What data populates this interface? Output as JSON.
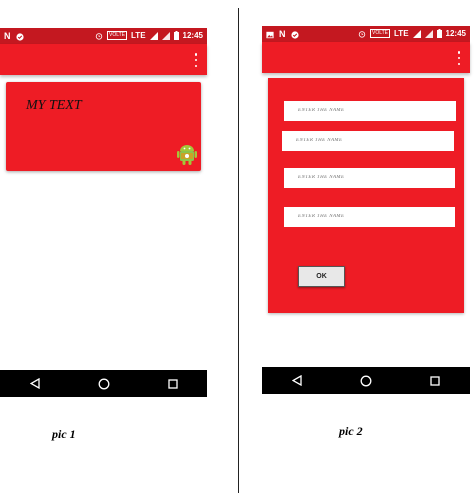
{
  "status_bar": {
    "time": "12:45",
    "network": "LTE",
    "volte": "VOLTE"
  },
  "pic1": {
    "card_text": "MY TEXT",
    "caption": "pic 1"
  },
  "pic2": {
    "fields": [
      {
        "placeholder": "ENTER THE NAME"
      },
      {
        "placeholder": "ENTER THE NAME"
      },
      {
        "placeholder": "ENTER THE NAME"
      },
      {
        "placeholder": "ENTER THE NAME"
      }
    ],
    "ok_label": "OK",
    "caption": "pic 2"
  },
  "colors": {
    "statusbar": "#c41820",
    "appbar": "#ee1c25",
    "card": "#ee1c25",
    "navbar": "#000000"
  },
  "icons": [
    "notification-n-icon",
    "check-circle-icon",
    "alarm-icon",
    "signal-icon",
    "battery-icon",
    "overflow-menu-icon",
    "back-icon",
    "home-icon",
    "recents-icon",
    "android-robot-icon",
    "image-icon"
  ]
}
